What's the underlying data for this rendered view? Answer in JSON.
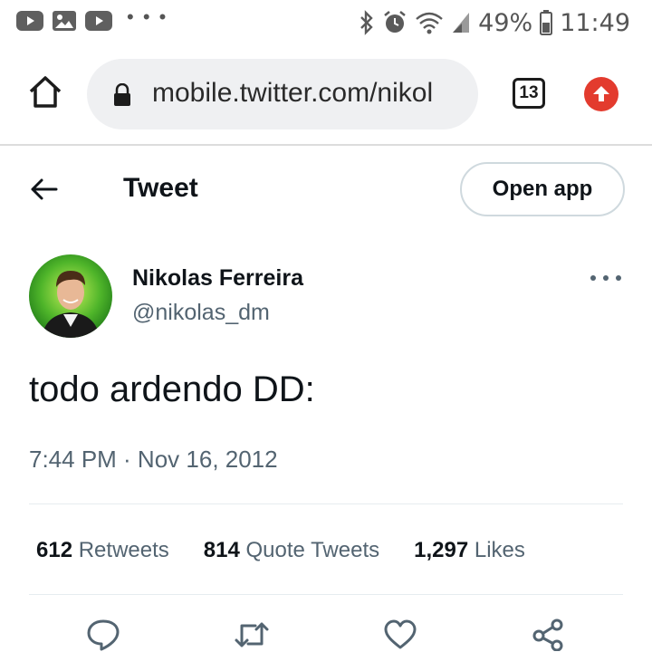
{
  "status_bar": {
    "left_icons": [
      "youtube-icon",
      "gallery-icon",
      "youtube-icon"
    ],
    "more": "• • •",
    "right_icons": [
      "bluetooth-icon",
      "alarm-icon",
      "wifi-icon",
      "signal-icon",
      "battery-icon"
    ],
    "battery": "49%",
    "time": "11:49"
  },
  "browser": {
    "url": "mobile.twitter.com/nikol",
    "tab_count": "13"
  },
  "header": {
    "title": "Tweet",
    "open_app_label": "Open app"
  },
  "tweet": {
    "author_name": "Nikolas Ferreira",
    "author_handle": "@nikolas_dm",
    "text": "todo ardendo DD:",
    "timestamp": "7:44 PM · Nov 16, 2012",
    "stats": [
      {
        "count": "612",
        "label": "Retweets"
      },
      {
        "count": "814",
        "label": "Quote Tweets"
      },
      {
        "count": "1,297",
        "label": "Likes"
      }
    ]
  },
  "colors": {
    "text_primary": "#0f1419",
    "text_secondary": "#536471",
    "upgrade_red": "#e33b2e",
    "avatar_green": "#3fa01f"
  }
}
